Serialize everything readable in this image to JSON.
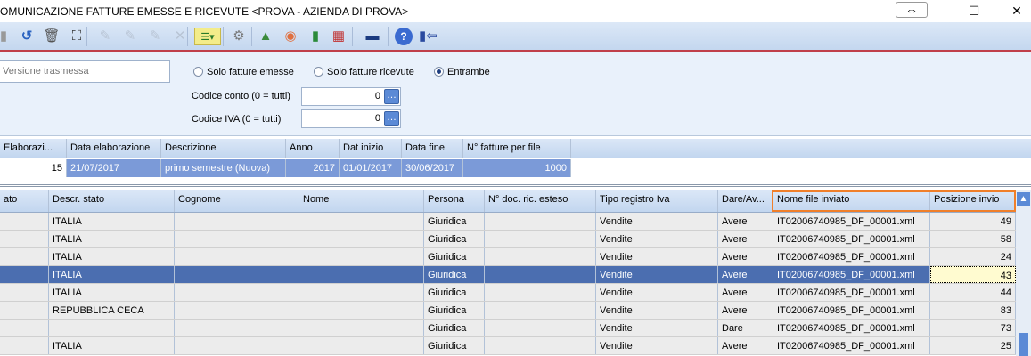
{
  "window": {
    "title": "OMUNICAZIONE FATTURE EMESSE E RICEVUTE <PROVA - AZIENDA DI PROVA>",
    "restore": "⇔",
    "minimize": "—",
    "maximize": "☐",
    "close": "✕"
  },
  "toolbar": {
    "icons": [
      "save-icon",
      "undo-icon",
      "trash-icon",
      "binoculars-icon",
      "doc-edit-icon",
      "doc-save-icon",
      "doc-undo-icon",
      "doc-cancel-icon",
      "list-options-icon",
      "gear-icon",
      "export-icon",
      "user-folder-icon",
      "book-icon",
      "grid-search-icon",
      "monitor-icon",
      "help-icon",
      "exit-icon"
    ]
  },
  "form": {
    "version_placeholder": "Versione trasmessa",
    "radio_emesse": "Solo fatture emesse",
    "radio_ricevute": "Solo fatture ricevute",
    "radio_entrambe": "Entrambe",
    "selected": "Entrambe",
    "codice_conto_label": "Codice conto (0 = tutti)",
    "codice_conto_value": "0",
    "codice_iva_label": "Codice IVA (0 = tutti)",
    "codice_iva_value": "0"
  },
  "top_table": {
    "headers": [
      "Elaborazi...",
      "Data elaborazione",
      "Descrizione",
      "Anno",
      "Dat inizio",
      "Data fine",
      "N° fatture per file"
    ],
    "row": [
      "15",
      "21/07/2017",
      "primo semestre (Nuova)",
      "2017",
      "01/01/2017",
      "30/06/2017",
      "1000"
    ]
  },
  "bottom_table": {
    "headers": [
      "ato",
      "Descr. stato",
      "Cognome",
      "Nome",
      "Persona",
      "N° doc. ric. esteso",
      "Tipo registro Iva",
      "Dare/Av...",
      "Nome file inviato",
      "Posizione invio"
    ],
    "highlight_color": "#f07f2a",
    "rows": [
      [
        "",
        "ITALIA",
        "",
        "",
        "Giuridica",
        "",
        "Vendite",
        "Avere",
        "IT02006740985_DF_00001.xml",
        "49"
      ],
      [
        "",
        "ITALIA",
        "",
        "",
        "Giuridica",
        "",
        "Vendite",
        "Avere",
        "IT02006740985_DF_00001.xml",
        "58"
      ],
      [
        "",
        "ITALIA",
        "",
        "",
        "Giuridica",
        "",
        "Vendite",
        "Avere",
        "IT02006740985_DF_00001.xml",
        "24"
      ],
      [
        "",
        "ITALIA",
        "",
        "",
        "Giuridica",
        "",
        "Vendite",
        "Avere",
        "IT02006740985_DF_00001.xml",
        "43"
      ],
      [
        "",
        "ITALIA",
        "",
        "",
        "Giuridica",
        "",
        "Vendite",
        "Avere",
        "IT02006740985_DF_00001.xml",
        "44"
      ],
      [
        "",
        "REPUBBLICA CECA",
        "",
        "",
        "Giuridica",
        "",
        "Vendite",
        "Avere",
        "IT02006740985_DF_00001.xml",
        "83"
      ],
      [
        "",
        "",
        "",
        "",
        "Giuridica",
        "",
        "Vendite",
        "Dare",
        "IT02006740985_DF_00001.xml",
        "73"
      ],
      [
        "",
        "ITALIA",
        "",
        "",
        "Giuridica",
        "",
        "Vendite",
        "Avere",
        "IT02006740985_DF_00001.xml",
        "25"
      ]
    ],
    "selected_row": 3
  }
}
